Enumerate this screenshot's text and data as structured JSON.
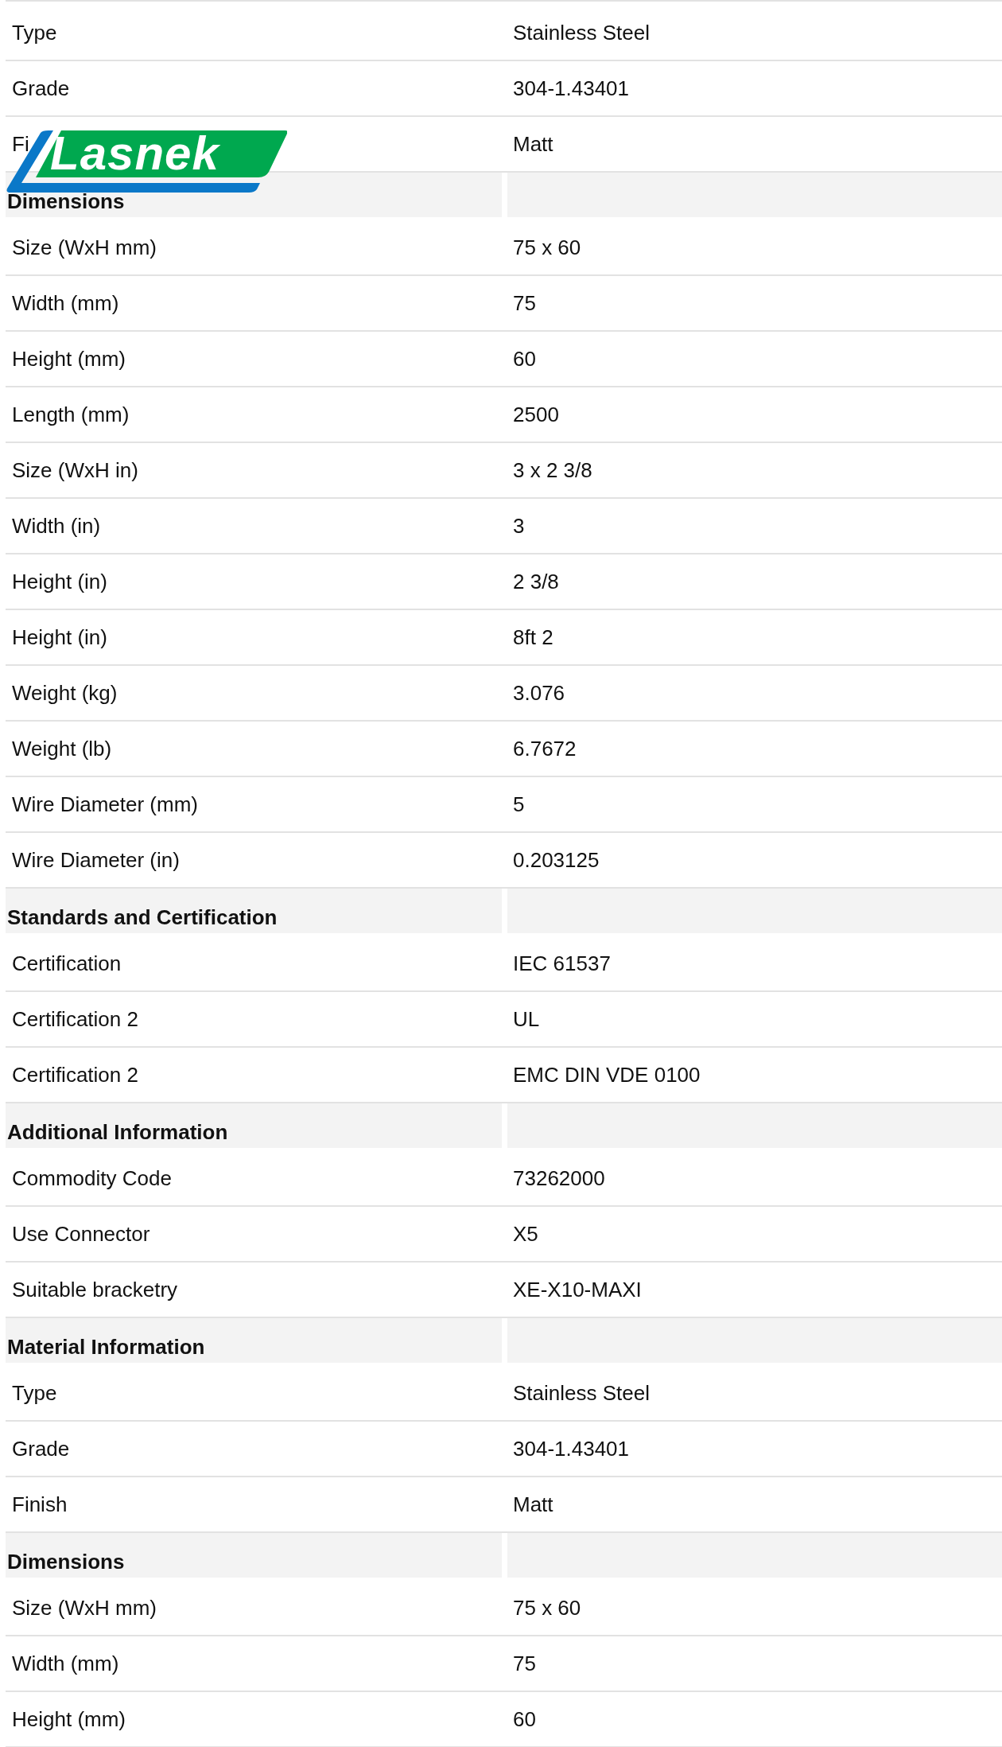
{
  "logo": {
    "text": "Lasnek"
  },
  "sections": [
    {
      "rows": [
        {
          "label": "Type",
          "value": "Stainless Steel"
        },
        {
          "label": "Grade",
          "value": "304-1.43401"
        },
        {
          "label": "Fi",
          "value": "Matt"
        }
      ]
    },
    {
      "title": "Dimensions",
      "rows": [
        {
          "label": "Size (WxH mm)",
          "value": "75 x 60"
        },
        {
          "label": "Width (mm)",
          "value": "75"
        },
        {
          "label": "Height (mm)",
          "value": "60"
        },
        {
          "label": "Length (mm)",
          "value": "2500"
        },
        {
          "label": "Size (WxH in)",
          "value": "3 x 2 3/8"
        },
        {
          "label": "Width (in)",
          "value": "3"
        },
        {
          "label": "Height (in)",
          "value": "2 3/8"
        },
        {
          "label": "Height (in)",
          "value": "8ft 2"
        },
        {
          "label": "Weight (kg)",
          "value": "3.076"
        },
        {
          "label": "Weight (lb)",
          "value": "6.7672"
        },
        {
          "label": "Wire Diameter (mm)",
          "value": "5"
        },
        {
          "label": "Wire Diameter (in)",
          "value": "0.203125"
        }
      ]
    },
    {
      "title": "Standards and Certification",
      "rows": [
        {
          "label": "Certification",
          "value": "IEC 61537"
        },
        {
          "label": "Certification 2",
          "value": "UL"
        },
        {
          "label": "Certification 2",
          "value": "EMC DIN VDE 0100"
        }
      ]
    },
    {
      "title": "Additional Information",
      "rows": [
        {
          "label": "Commodity Code",
          "value": "73262000"
        },
        {
          "label": "Use Connector",
          "value": "X5"
        },
        {
          "label": "Suitable bracketry",
          "value": "XE-X10-MAXI"
        }
      ]
    },
    {
      "title": "Material Information",
      "rows": [
        {
          "label": "Type",
          "value": "Stainless Steel"
        },
        {
          "label": "Grade",
          "value": "304-1.43401"
        },
        {
          "label": "Finish",
          "value": "Matt"
        }
      ]
    },
    {
      "title": "Dimensions",
      "rows": [
        {
          "label": "Size (WxH mm)",
          "value": "75 x 60"
        },
        {
          "label": "Width (mm)",
          "value": "75"
        },
        {
          "label": "Height (mm)",
          "value": "60"
        }
      ]
    }
  ]
}
